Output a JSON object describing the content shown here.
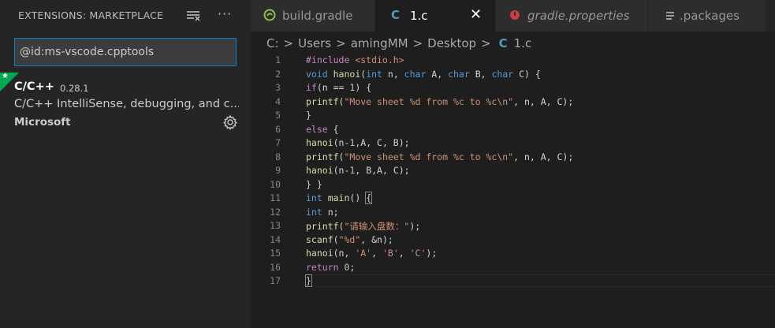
{
  "sidebar": {
    "title": "EXTENSIONS: MARKETPLACE",
    "clear_icon": "clear-results-icon",
    "more_label": "···",
    "search_value": "@id:ms-vscode.cpptools",
    "extension": {
      "badge_icon": "star-icon",
      "badge_glyph": "★",
      "name": "C/C++",
      "version": "0.28.1",
      "description": "C/C++ IntelliSense, debugging, and c...",
      "publisher": "Microsoft",
      "gear_icon": "gear-icon"
    }
  },
  "tabs": [
    {
      "label": "build.gradle",
      "icon": "gradle-icon",
      "icon_color": "#8dc149"
    },
    {
      "label": "1.c",
      "icon": "c-file-icon",
      "icon_glyph": "C",
      "icon_color": "#519aba",
      "active": true,
      "close": "✕"
    },
    {
      "label": "gradle.properties",
      "icon": "properties-icon",
      "icon_color": "#cc3e44",
      "italic": true
    },
    {
      "label": ".packages",
      "icon": "file-lines-icon",
      "icon_color": "#c5c5c5"
    }
  ],
  "breadcrumb": {
    "items": [
      "C:",
      "Users",
      "amingMM",
      "Desktop"
    ],
    "separator": ">",
    "file_icon": "C",
    "file": "1.c"
  },
  "editor": {
    "line_numbers": [
      "1",
      "2",
      "3",
      "4",
      "5",
      "6",
      "7",
      "8",
      "9",
      "10",
      "11",
      "12",
      "13",
      "14",
      "15",
      "16",
      "17"
    ],
    "lines": [
      [
        {
          "t": "#include ",
          "c": "pp"
        },
        {
          "t": "<stdio.h>",
          "c": "str"
        }
      ],
      [
        {
          "t": "void ",
          "c": "kw"
        },
        {
          "t": "hanoi",
          "c": "fn"
        },
        {
          "t": "(",
          "c": "pl"
        },
        {
          "t": "int ",
          "c": "kw"
        },
        {
          "t": "n, ",
          "c": "pl"
        },
        {
          "t": "char ",
          "c": "kw"
        },
        {
          "t": "A, ",
          "c": "pl"
        },
        {
          "t": "char ",
          "c": "kw"
        },
        {
          "t": "B, ",
          "c": "pl"
        },
        {
          "t": "char ",
          "c": "kw"
        },
        {
          "t": "C) {",
          "c": "pl"
        }
      ],
      [
        {
          "t": "if",
          "c": "pp"
        },
        {
          "t": "(n == ",
          "c": "pl"
        },
        {
          "t": "1",
          "c": "num"
        },
        {
          "t": ") {",
          "c": "pl"
        }
      ],
      [
        {
          "t": "printf",
          "c": "fn"
        },
        {
          "t": "(",
          "c": "pl"
        },
        {
          "t": "\"Move sheet %d from %c to %c\\n\"",
          "c": "str"
        },
        {
          "t": ", n, A, C);",
          "c": "pl"
        }
      ],
      [
        {
          "t": "}",
          "c": "pl"
        }
      ],
      [
        {
          "t": "else",
          "c": "pp"
        },
        {
          "t": " {",
          "c": "pl"
        }
      ],
      [
        {
          "t": "hanoi",
          "c": "fn"
        },
        {
          "t": "(n-",
          "c": "pl"
        },
        {
          "t": "1",
          "c": "num"
        },
        {
          "t": ",A, C, B);",
          "c": "pl"
        }
      ],
      [
        {
          "t": "printf",
          "c": "fn"
        },
        {
          "t": "(",
          "c": "pl"
        },
        {
          "t": "\"Move sheet %d from %c to %c\\n\"",
          "c": "str"
        },
        {
          "t": ", n, A, C);",
          "c": "pl"
        }
      ],
      [
        {
          "t": "hanoi",
          "c": "fn"
        },
        {
          "t": "(n-",
          "c": "pl"
        },
        {
          "t": "1",
          "c": "num"
        },
        {
          "t": ", B,A, C);",
          "c": "pl"
        }
      ],
      [
        {
          "t": "} }",
          "c": "pl"
        }
      ],
      [
        {
          "t": "int ",
          "c": "kw"
        },
        {
          "t": "main",
          "c": "fn"
        },
        {
          "t": "() ",
          "c": "pl"
        },
        {
          "t": "{",
          "c": "pl",
          "hl": true
        }
      ],
      [
        {
          "t": "int ",
          "c": "kw"
        },
        {
          "t": "n;",
          "c": "pl"
        }
      ],
      [
        {
          "t": "printf",
          "c": "fn"
        },
        {
          "t": "(",
          "c": "pl"
        },
        {
          "t": "\"请输入盘数：\"",
          "c": "str"
        },
        {
          "t": ");",
          "c": "pl"
        }
      ],
      [
        {
          "t": "scanf",
          "c": "fn"
        },
        {
          "t": "(",
          "c": "pl"
        },
        {
          "t": "\"%d\"",
          "c": "str"
        },
        {
          "t": ", &n);",
          "c": "pl"
        }
      ],
      [
        {
          "t": "hanoi",
          "c": "fn"
        },
        {
          "t": "(n, ",
          "c": "pl"
        },
        {
          "t": "'A'",
          "c": "str"
        },
        {
          "t": ", ",
          "c": "pl"
        },
        {
          "t": "'B'",
          "c": "str"
        },
        {
          "t": ", ",
          "c": "pl"
        },
        {
          "t": "'C'",
          "c": "str"
        },
        {
          "t": ");",
          "c": "pl"
        }
      ],
      [
        {
          "t": "return ",
          "c": "pp"
        },
        {
          "t": "0",
          "c": "num"
        },
        {
          "t": ";",
          "c": "pl"
        }
      ],
      [
        {
          "t": "}",
          "c": "pl",
          "hl": true
        }
      ]
    ]
  }
}
